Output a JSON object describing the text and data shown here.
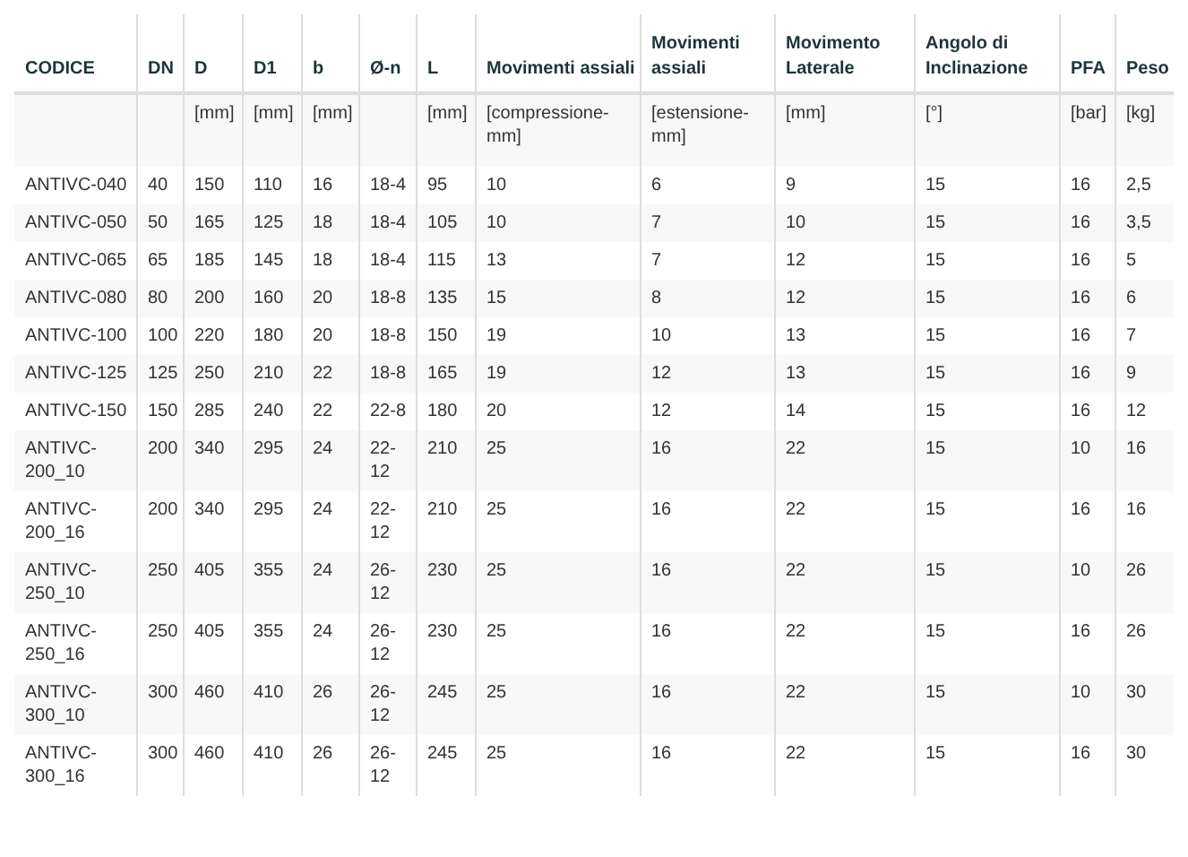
{
  "table": {
    "columns": [
      {
        "label": "CODICE"
      },
      {
        "label": "DN"
      },
      {
        "label": "D",
        "unit": "[mm]"
      },
      {
        "label": "D1",
        "unit": "[mm]"
      },
      {
        "label": "b",
        "unit": "[mm]"
      },
      {
        "label": "Ø-n"
      },
      {
        "label": "L",
        "unit": "[mm]"
      },
      {
        "label": "Movimenti assiali",
        "unit": "[compressione-mm]"
      },
      {
        "label": "Movimenti assiali",
        "unit": "[estensione-mm]"
      },
      {
        "label": "Movimento Laterale",
        "unit": "[mm]"
      },
      {
        "label": "Angolo di Inclinazione",
        "unit": "[°]"
      },
      {
        "label": "PFA",
        "unit": "[bar]"
      },
      {
        "label": "Peso",
        "unit": "[kg]"
      }
    ],
    "rows": [
      [
        "ANTIVC-040",
        "40",
        "150",
        "110",
        "16",
        "18-4",
        "95",
        "10",
        "6",
        "9",
        "15",
        "16",
        "2,5"
      ],
      [
        "ANTIVC-050",
        "50",
        "165",
        "125",
        "18",
        "18-4",
        "105",
        "10",
        "7",
        "10",
        "15",
        "16",
        "3,5"
      ],
      [
        "ANTIVC-065",
        "65",
        "185",
        "145",
        "18",
        "18-4",
        "115",
        "13",
        "7",
        "12",
        "15",
        "16",
        "5"
      ],
      [
        "ANTIVC-080",
        "80",
        "200",
        "160",
        "20",
        "18-8",
        "135",
        "15",
        "8",
        "12",
        "15",
        "16",
        "6"
      ],
      [
        "ANTIVC-100",
        "100",
        "220",
        "180",
        "20",
        "18-8",
        "150",
        "19",
        "10",
        "13",
        "15",
        "16",
        "7"
      ],
      [
        "ANTIVC-125",
        "125",
        "250",
        "210",
        "22",
        "18-8",
        "165",
        "19",
        "12",
        "13",
        "15",
        "16",
        "9"
      ],
      [
        "ANTIVC-150",
        "150",
        "285",
        "240",
        "22",
        "22-8",
        "180",
        "20",
        "12",
        "14",
        "15",
        "16",
        "12"
      ],
      [
        "ANTIVC-200_10",
        "200",
        "340",
        "295",
        "24",
        "22-12",
        "210",
        "25",
        "16",
        "22",
        "15",
        "10",
        "16"
      ],
      [
        "ANTIVC-200_16",
        "200",
        "340",
        "295",
        "24",
        "22-12",
        "210",
        "25",
        "16",
        "22",
        "15",
        "16",
        "16"
      ],
      [
        "ANTIVC-250_10",
        "250",
        "405",
        "355",
        "24",
        "26-12",
        "230",
        "25",
        "16",
        "22",
        "15",
        "10",
        "26"
      ],
      [
        "ANTIVC-250_16",
        "250",
        "405",
        "355",
        "24",
        "26-12",
        "230",
        "25",
        "16",
        "22",
        "15",
        "16",
        "26"
      ],
      [
        "ANTIVC-300_10",
        "300",
        "460",
        "410",
        "26",
        "26-12",
        "245",
        "25",
        "16",
        "22",
        "15",
        "10",
        "30"
      ],
      [
        "ANTIVC-300_16",
        "300",
        "460",
        "410",
        "26",
        "26-12",
        "245",
        "25",
        "16",
        "22",
        "15",
        "16",
        "30"
      ]
    ]
  }
}
